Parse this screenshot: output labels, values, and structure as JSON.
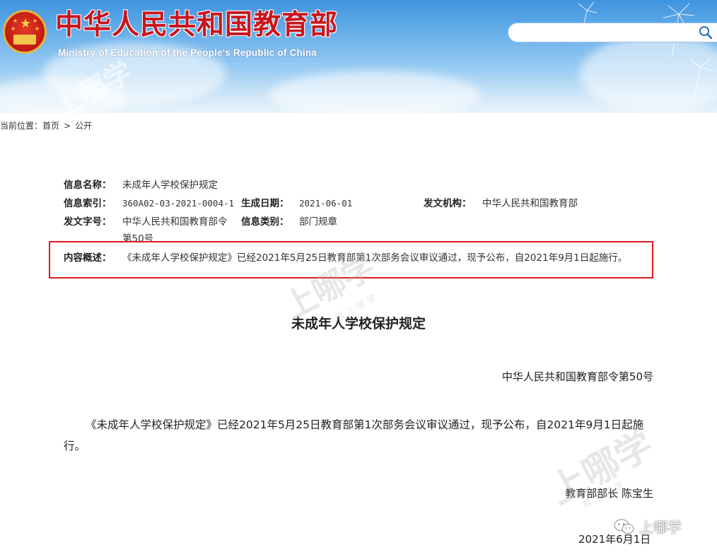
{
  "header": {
    "title_cn": "中华人民共和国教育部",
    "title_en": "Ministry of Education of the People's Republic of China",
    "search_icon": "search-icon"
  },
  "breadcrumb": {
    "prefix": "当前位置：",
    "items": [
      "首页",
      "公开"
    ],
    "separator": ">"
  },
  "meta": {
    "name_label": "信息名称：",
    "name_value": "未成年人学校保护规定",
    "index_label": "信息索引：",
    "index_value": "360A02-03-2021-0004-1",
    "date_label": "生成日期：",
    "date_value": "2021-06-01",
    "org_label": "发文机构：",
    "org_value": "中华人民共和国教育部",
    "docno_label": "发文字号：",
    "docno_value_line1": "中华人民共和国教育部令",
    "docno_value_line2": "第50号",
    "category_label": "信息类别：",
    "category_value": "部门规章",
    "summary_label": "内容概述：",
    "summary_value": "《未成年人学校保护规定》已经2021年5月25日教育部第1次部务会议审议通过，现予公布，自2021年9月1日起施行。"
  },
  "document": {
    "title": "未成年人学校保护规定",
    "order_number": "中华人民共和国教育部令第50号",
    "body": "《未成年人学校保护规定》已经2021年5月25日教育部第1次部务会议审议通过，现予公布，自2021年9月1日起施行。",
    "signer": "教育部部长 陈宝生",
    "date": "2021年6月1日"
  },
  "watermark": {
    "text": "上哪学",
    "sub": "用 上 哪 学"
  },
  "wechat": {
    "icon": "wechat-icon",
    "label": "上哪学"
  },
  "colors": {
    "title_red": "#c8161d",
    "highlight_border": "#e0191c"
  }
}
